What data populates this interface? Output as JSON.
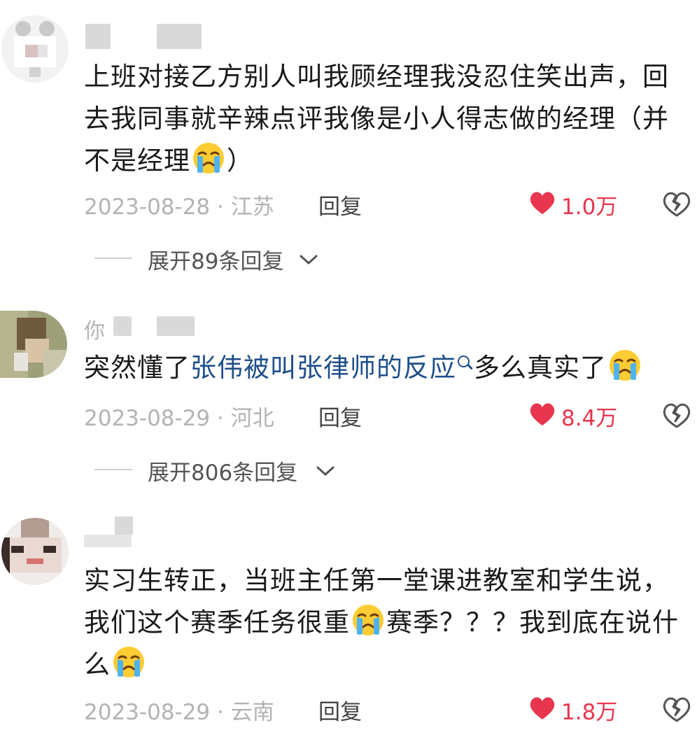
{
  "comments": [
    {
      "username_visible": "",
      "body_lines": [
        "上班对接乙方别人叫我顾经理我没忍住笑出声，回",
        "去我同事就辛辣点评我像是小人得志做的经理（并",
        "不是经理"
      ],
      "body_tail": "）",
      "date": "2023-08-28 · 江苏",
      "reply_label": "回复",
      "likes": "1.0万",
      "expand_label": "展开89条回复"
    },
    {
      "username_visible": "你",
      "body_prefix": "突然懂了",
      "body_link": "张伟被叫张律师的反应",
      "body_suffix": "多么真实了",
      "date": "2023-08-29 · 河北",
      "reply_label": "回复",
      "likes": "8.4万",
      "expand_label": "展开806条回复"
    },
    {
      "username_visible": "",
      "body_lines": [
        "实习生转正，当班主任第一堂课进教室和学生说，"
      ],
      "body_line2_a": "我们这个赛季任务很重",
      "body_line2_b": "赛季？？？我到底在说什",
      "body_line3": "么",
      "date": "2023-08-29 · 云南",
      "reply_label": "回复",
      "likes": "1.8万"
    }
  ],
  "icons": {
    "like": "heart-filled-icon",
    "dislike": "broken-heart-icon",
    "emoji": "crying-face-emoji",
    "expand": "chevron-down-icon",
    "link_search": "search-icon"
  },
  "colors": {
    "like_red": "#e8364e",
    "link_blue": "#1f4f8a",
    "meta_gray": "#b3b3b3"
  }
}
